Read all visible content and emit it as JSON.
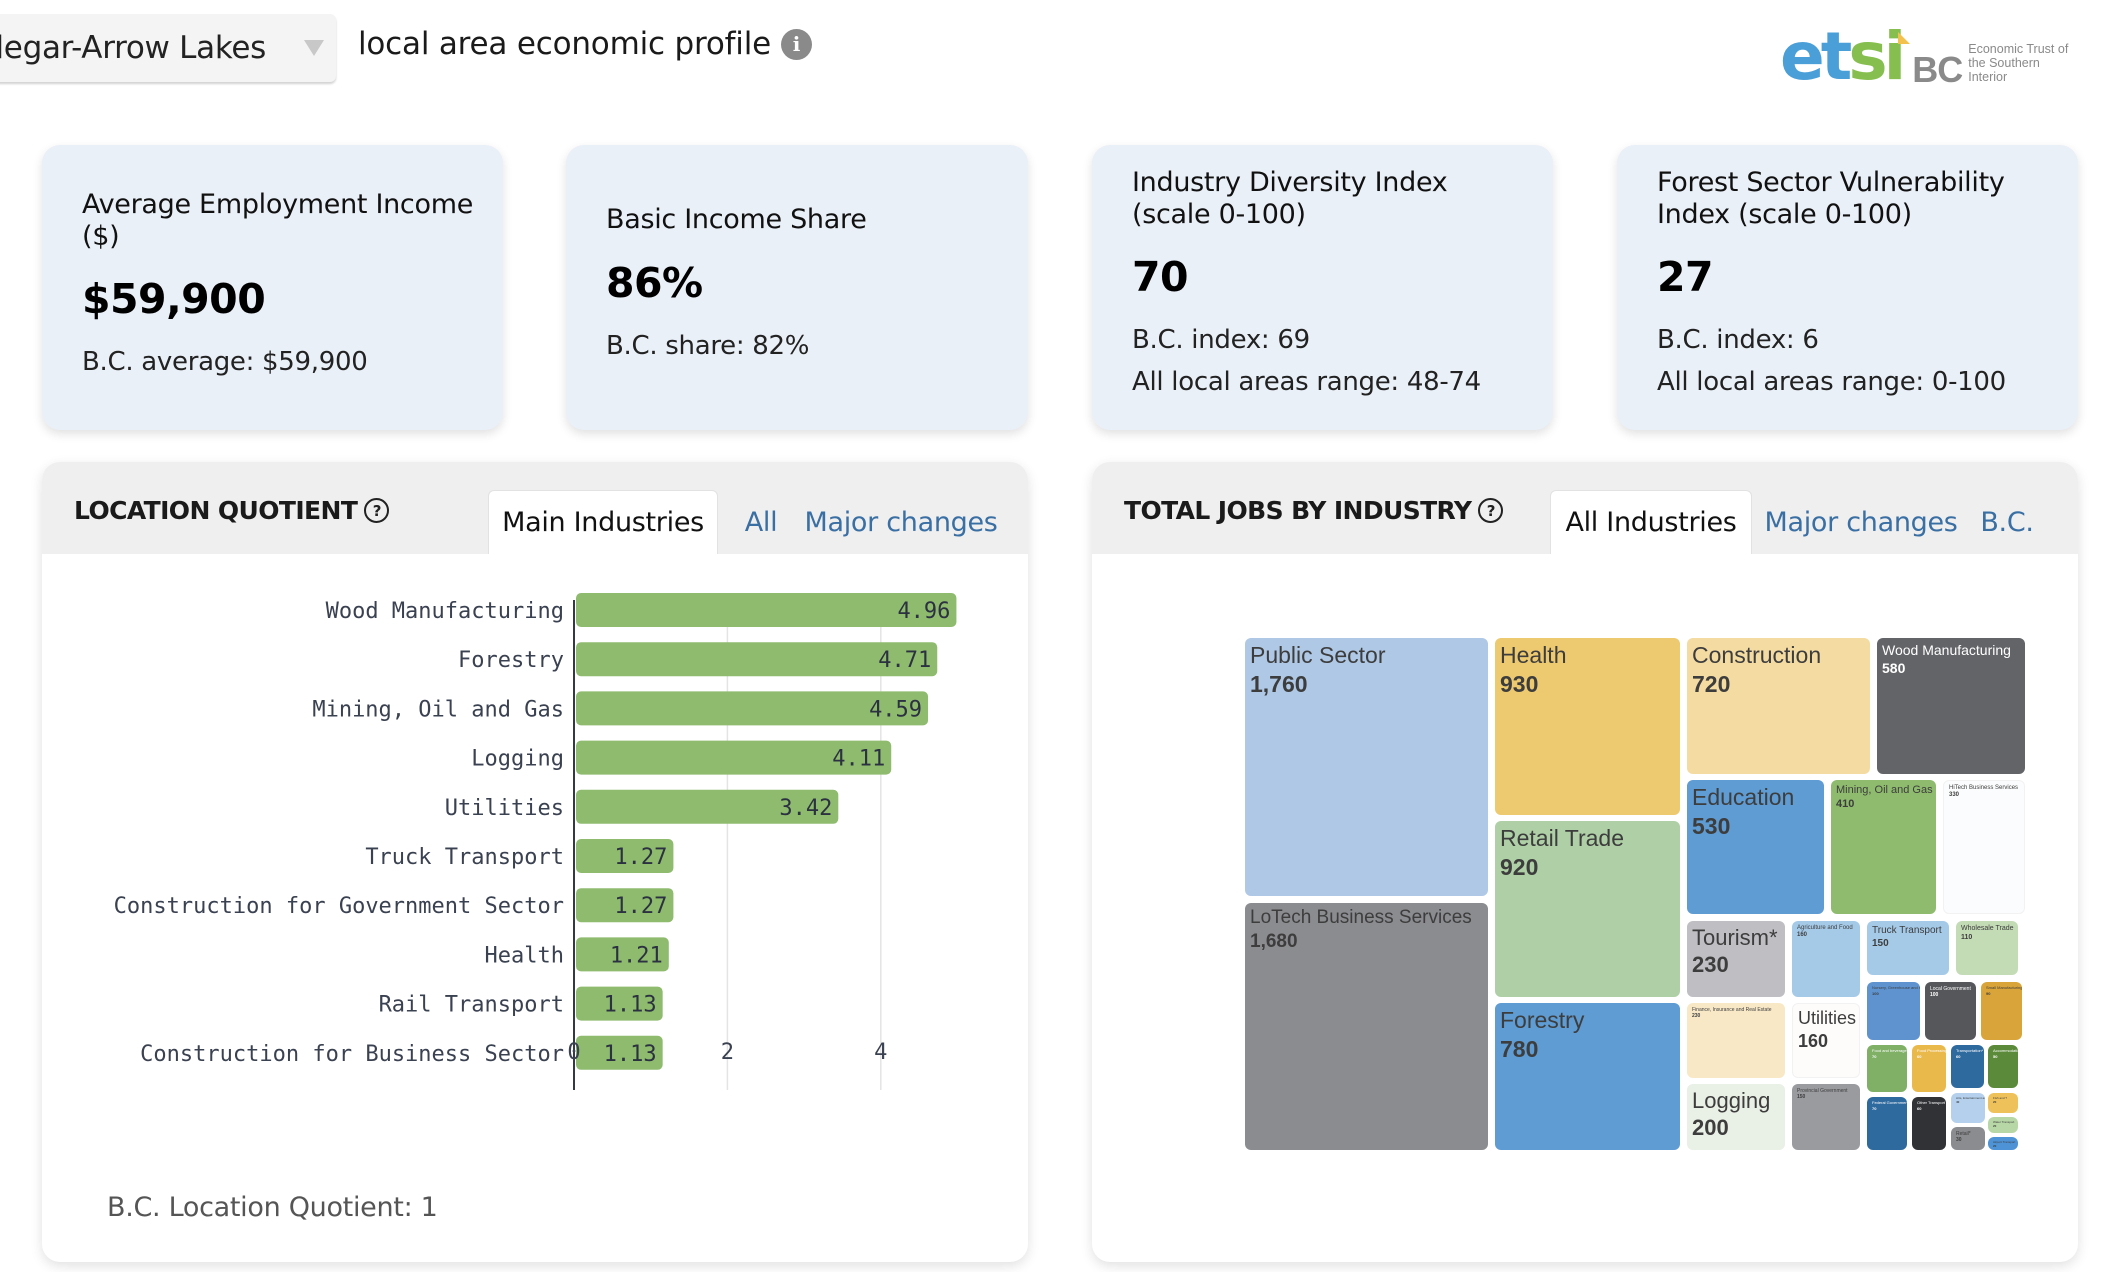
{
  "header": {
    "region_dropdown": {
      "selected": "Castlegar-Arrow Lakes",
      "visible_text": "tlegar-Arrow Lakes"
    },
    "title": "local area economic profile",
    "info_icon": "info-icon",
    "logo": {
      "etsi": "etsi",
      "bc": "BC",
      "tagline_line1": "Economic Trust of",
      "tagline_line2": "the Southern Interior"
    }
  },
  "cards": [
    {
      "label_line1": "Average Employment Income",
      "label_line2": "($)",
      "value": "$59,900",
      "sub1": "B.C. average: $59,900",
      "sub2": ""
    },
    {
      "label_line1": "Basic Income Share",
      "label_line2": "",
      "value": "86%",
      "sub1": "B.C. share: 82%",
      "sub2": ""
    },
    {
      "label_line1": "Industry Diversity Index",
      "label_line2": "(scale 0-100)",
      "value": "70",
      "sub1": "B.C. index: 69",
      "sub2": "All local areas range: 48-74"
    },
    {
      "label_line1": "Forest Sector Vulnerability",
      "label_line2": "Index (scale 0-100)",
      "value": "27",
      "sub1": "B.C. index: 6",
      "sub2": "All local areas range: 0-100"
    }
  ],
  "location_quotient": {
    "title": "LOCATION QUOTIENT",
    "tabs": [
      {
        "label": "Main Industries",
        "active": true
      },
      {
        "label": "All",
        "active": false
      },
      {
        "label": "Major changes",
        "active": false
      }
    ],
    "footnote": "B.C. Location Quotient: 1"
  },
  "total_jobs": {
    "title": "TOTAL JOBS BY INDUSTRY",
    "tabs": [
      {
        "label": "All Industries",
        "active": true
      },
      {
        "label": "Major changes",
        "active": false
      },
      {
        "label": "B.C.",
        "active": false
      }
    ]
  },
  "chart_data": [
    {
      "type": "bar",
      "orientation": "horizontal",
      "title": "Location Quotient - Main Industries",
      "categories": [
        "Wood Manufacturing",
        "Forestry",
        "Mining, Oil and Gas",
        "Logging",
        "Utilities",
        "Truck Transport",
        "Construction for Government Sector",
        "Health",
        "Rail Transport",
        "Construction for Business Sector"
      ],
      "values": [
        4.96,
        4.71,
        4.59,
        4.11,
        3.42,
        1.27,
        1.27,
        1.21,
        1.13,
        1.13
      ],
      "value_labels": [
        "4.96",
        "4.71",
        "4.59",
        "4.11",
        "3.42",
        "1.27",
        "1.27",
        "1.21",
        "1.13",
        "1.13"
      ],
      "xlabel": "",
      "ylabel": "",
      "xlim": [
        0,
        5.2
      ],
      "xticks": [
        0,
        2,
        4
      ],
      "grid": true,
      "bar_color": "#8fbb6e"
    },
    {
      "type": "treemap",
      "title": "Total Jobs by Industry - All Industries",
      "items": [
        {
          "name": "Public Sector",
          "value": 1760,
          "label": "1,760",
          "color": "#aec8e6"
        },
        {
          "name": "LoTech Business Services",
          "value": 1680,
          "label": "1,680",
          "color": "#8b8c90"
        },
        {
          "name": "Health",
          "value": 930,
          "label": "930",
          "color": "#edc96f"
        },
        {
          "name": "Retail Trade",
          "value": 920,
          "label": "920",
          "color": "#afd0a6"
        },
        {
          "name": "Forestry",
          "value": 780,
          "label": "780",
          "color": "#5e9cd3"
        },
        {
          "name": "Construction",
          "value": 720,
          "label": "720",
          "color": "#f4dba2"
        },
        {
          "name": "Wood Manufacturing",
          "value": 580,
          "label": "580",
          "color": "#636468"
        },
        {
          "name": "Education",
          "value": 530,
          "label": "530",
          "color": "#5e9cd3"
        },
        {
          "name": "Mining, Oil and Gas",
          "value": 410,
          "label": "410",
          "color": "#8fbb6e"
        },
        {
          "name": "HiTech Business Services",
          "value": 330,
          "label": "330",
          "color": "#fbfcfd"
        },
        {
          "name": "Tourism*",
          "value": 230,
          "label": "230",
          "color": "#bfbfc3"
        },
        {
          "name": "Finance, Insurance and Real Estate",
          "value": 230,
          "label": "230",
          "color": "#f8e8c6"
        },
        {
          "name": "Logging",
          "value": 200,
          "label": "200",
          "color": "#e9f0e5"
        },
        {
          "name": "Agriculture and Food",
          "value": 160,
          "label": "160",
          "color": "#a5cae8"
        },
        {
          "name": "Utilities",
          "value": 160,
          "label": "160",
          "color": "#fdfcfa"
        },
        {
          "name": "Provincial Government",
          "value": 150,
          "label": "150",
          "color": "#9a9b9f"
        },
        {
          "name": "Truck Transport",
          "value": 150,
          "label": "150",
          "color": "#a5cae8"
        },
        {
          "name": "Wholesale Trade",
          "value": 110,
          "label": "110",
          "color": "#c4dcb6"
        },
        {
          "name": "Nursery, Greenhouse and Horticulture",
          "value": 100,
          "label": "100",
          "color": "#5e93cf"
        },
        {
          "name": "Local Government",
          "value": 100,
          "label": "100",
          "color": "#55575b"
        },
        {
          "name": "Small Manufacturing",
          "value": 90,
          "label": "90",
          "color": "#d9a43a"
        },
        {
          "name": "Food and beverage*",
          "value": 70,
          "label": "70",
          "color": "#7fb066"
        },
        {
          "name": "Food Processing",
          "value": 60,
          "label": "60",
          "color": "#eab94c"
        },
        {
          "name": "Transportation*",
          "value": 60,
          "label": "60",
          "color": "#2f6a9f"
        },
        {
          "name": "Accommodation*",
          "value": 50,
          "label": "50",
          "color": "#5b8a3a"
        },
        {
          "name": "Federal Government",
          "value": 70,
          "label": "70",
          "color": "#2f6a9f"
        },
        {
          "name": "Other Transport",
          "value": 60,
          "label": "60",
          "color": "#303236"
        },
        {
          "name": "Arts, Entertainment and Recreation",
          "value": 40,
          "label": "40",
          "color": "#b4d0ec"
        },
        {
          "name": "Retail*",
          "value": 30,
          "label": "30",
          "color": "#8b8c90"
        },
        {
          "name": "Fish and ?",
          "value": 20,
          "label": "20",
          "color": "#eec15a"
        },
        {
          "name": "Water Transport",
          "value": 20,
          "label": "20",
          "color": "#b8d7a6"
        },
        {
          "name": "Airport Transport",
          "value": 20,
          "label": "20",
          "color": "#4e93d6"
        }
      ]
    }
  ]
}
